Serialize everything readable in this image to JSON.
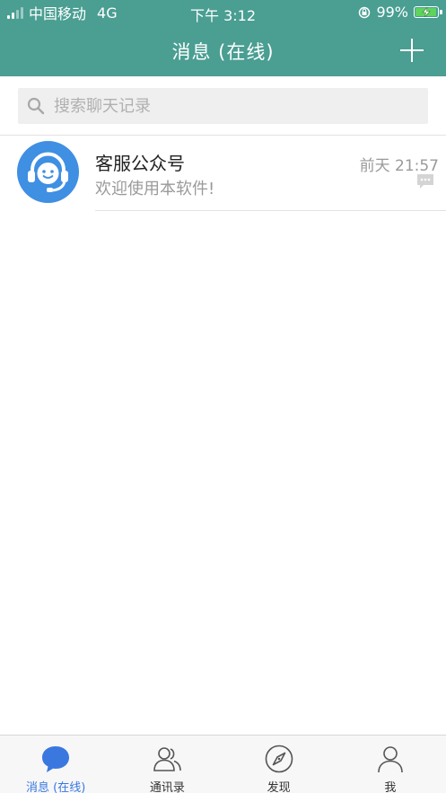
{
  "status_bar": {
    "carrier": "中国移动",
    "network": "4G",
    "time": "下午 3:12",
    "battery_percent": "99%",
    "battery_level": 0.99
  },
  "header": {
    "title": "消息 (在线)",
    "add_icon": "plus-icon"
  },
  "search": {
    "placeholder": "搜索聊天记录",
    "icon": "search-icon"
  },
  "conversations": [
    {
      "name": "客服公众号",
      "preview": "欢迎使用本软件!",
      "time": "前天 21:57",
      "avatar_icon": "headset-support-icon"
    }
  ],
  "tabbar": {
    "tabs": [
      {
        "label": "消息 (在线)",
        "icon": "chat-bubble-icon",
        "active": true
      },
      {
        "label": "通讯录",
        "icon": "contacts-icon",
        "active": false
      },
      {
        "label": "发现",
        "icon": "compass-icon",
        "active": false
      },
      {
        "label": "我",
        "icon": "person-icon",
        "active": false
      }
    ]
  },
  "colors": {
    "header": "#4a9e92",
    "accent": "#3a78e0",
    "avatar": "#3f8fe3"
  }
}
